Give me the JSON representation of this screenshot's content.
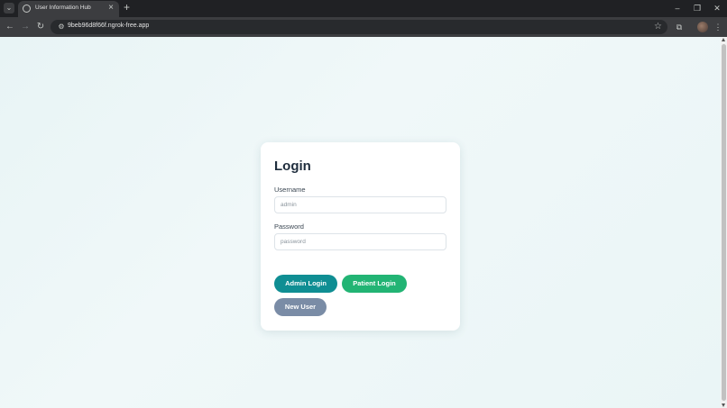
{
  "browser": {
    "tab_title": "User Information Hub",
    "tab_close_icon": "×",
    "new_tab_icon": "+",
    "url": "9beb96d8f66f.ngrok-free.app",
    "window_controls": {
      "minimize": "–",
      "restore": "❐",
      "close": "✕"
    },
    "icons": {
      "tab_search": "chevron-down-icon",
      "back": "back-arrow-icon",
      "forward": "forward-arrow-icon",
      "reload": "reload-icon",
      "site_info": "site-info-icon",
      "bookmark": "star-icon",
      "extensions": "puzzle-icon",
      "menu": "kebab-menu-icon"
    }
  },
  "login": {
    "title": "Login",
    "username_label": "Username",
    "username_placeholder": "admin",
    "password_label": "Password",
    "password_placeholder": "password",
    "admin_button": "Admin Login",
    "patient_button": "Patient Login",
    "new_user_button": "New User"
  },
  "colors": {
    "admin_button": "#0f8e93",
    "patient_button": "#22b474",
    "new_user_button": "#7a8ca6",
    "page_background": "#eaf5f6"
  }
}
